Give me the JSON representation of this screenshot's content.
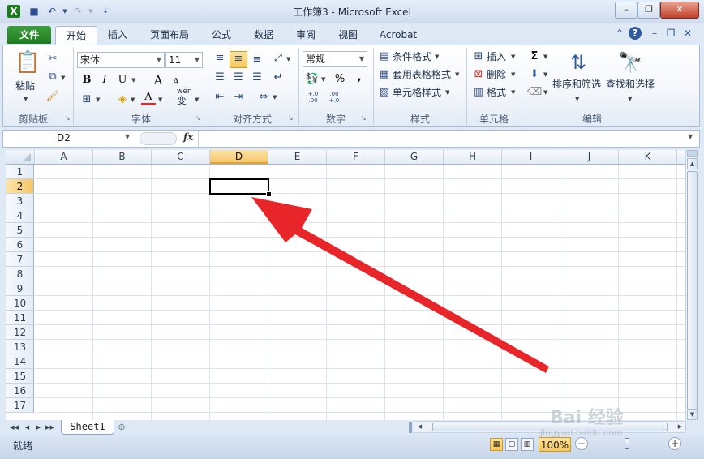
{
  "window": {
    "title": "工作簿3 - Microsoft Excel",
    "controls": {
      "minimize": "–",
      "restore": "❐",
      "close": "✕"
    }
  },
  "quick_access": [
    "excel-logo-icon",
    "save-icon",
    "undo-icon",
    "redo-icon"
  ],
  "tabs": [
    {
      "label": "文件"
    },
    {
      "label": "开始"
    },
    {
      "label": "插入"
    },
    {
      "label": "页面布局"
    },
    {
      "label": "公式"
    },
    {
      "label": "数据"
    },
    {
      "label": "审阅"
    },
    {
      "label": "视图"
    },
    {
      "label": "Acrobat"
    }
  ],
  "ribbon": {
    "clipboard": {
      "paste_label": "粘贴",
      "group_label": "剪贴板"
    },
    "font": {
      "font_name": "宋体",
      "font_size": "11",
      "bold": "B",
      "italic": "I",
      "underline": "U",
      "grow": "A",
      "shrink": "A",
      "font_color": "A",
      "phonetic": "wén",
      "phonetic_char": "变",
      "group_label": "字体"
    },
    "alignment": {
      "group_label": "对齐方式"
    },
    "number": {
      "format": "常规",
      "percent": "%",
      "comma": ",",
      "inc_decimal": "+.0 .00",
      "dec_decimal": ".00 +.0",
      "group_label": "数字"
    },
    "styles": {
      "conditional": "条件格式",
      "table_format": "套用表格格式",
      "cell_styles": "单元格样式",
      "group_label": "样式"
    },
    "cells": {
      "insert": "插入",
      "delete": "删除",
      "format": "格式",
      "group_label": "单元格"
    },
    "editing": {
      "sum": "Σ",
      "sort_filter": "排序和筛选",
      "find_select": "查找和选择",
      "group_label": "编辑"
    }
  },
  "formula_bar": {
    "name_box": "D2",
    "fx": "fx",
    "value": ""
  },
  "sheet": {
    "columns": [
      "A",
      "B",
      "C",
      "D",
      "E",
      "F",
      "G",
      "H",
      "I",
      "J",
      "K"
    ],
    "rows": [
      "1",
      "2",
      "3",
      "4",
      "5",
      "6",
      "7",
      "8",
      "9",
      "10",
      "11",
      "12",
      "13",
      "14",
      "15",
      "16",
      "17"
    ],
    "active_cell": "D2",
    "tab_name": "Sheet1"
  },
  "status": {
    "text": "就绪",
    "zoom": "100%"
  },
  "watermark": {
    "text": "Bai 经验",
    "sub": "jingyan.baidu.com"
  },
  "colors": {
    "file_tab": "#1e7c1e",
    "selection_highlight": "#f7c85a",
    "arrow": "#e8262a"
  }
}
